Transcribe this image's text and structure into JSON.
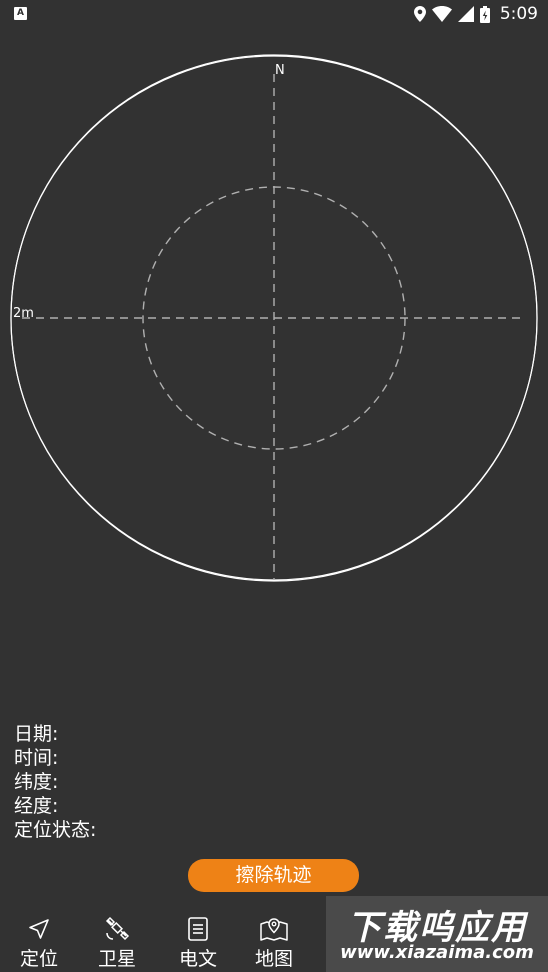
{
  "status_bar": {
    "time": "5:09",
    "icons": [
      "app-notification-icon",
      "location-icon",
      "wifi-icon",
      "cell-signal-icon",
      "battery-charging-icon"
    ],
    "app_icon_letter": "A"
  },
  "plot": {
    "north_label": "N",
    "scale_label": "2m"
  },
  "info": {
    "date_label": "日期:",
    "time_label": "时间:",
    "latitude_label": "纬度:",
    "longitude_label": "经度:",
    "status_label": "定位状态:"
  },
  "clear_button_label": "擦除轨迹",
  "nav": {
    "items": [
      {
        "label": "定位",
        "icon": "navigation-arrow-icon"
      },
      {
        "label": "卫星",
        "icon": "satellite-icon"
      },
      {
        "label": "电文",
        "icon": "document-icon"
      },
      {
        "label": "地图",
        "icon": "map-pin-icon"
      }
    ]
  },
  "watermark": {
    "title": "下载呜应用",
    "url": "www.xiazaima.com"
  },
  "colors": {
    "background": "#323232",
    "accent": "#ee8216",
    "foreground": "#ffffff"
  }
}
